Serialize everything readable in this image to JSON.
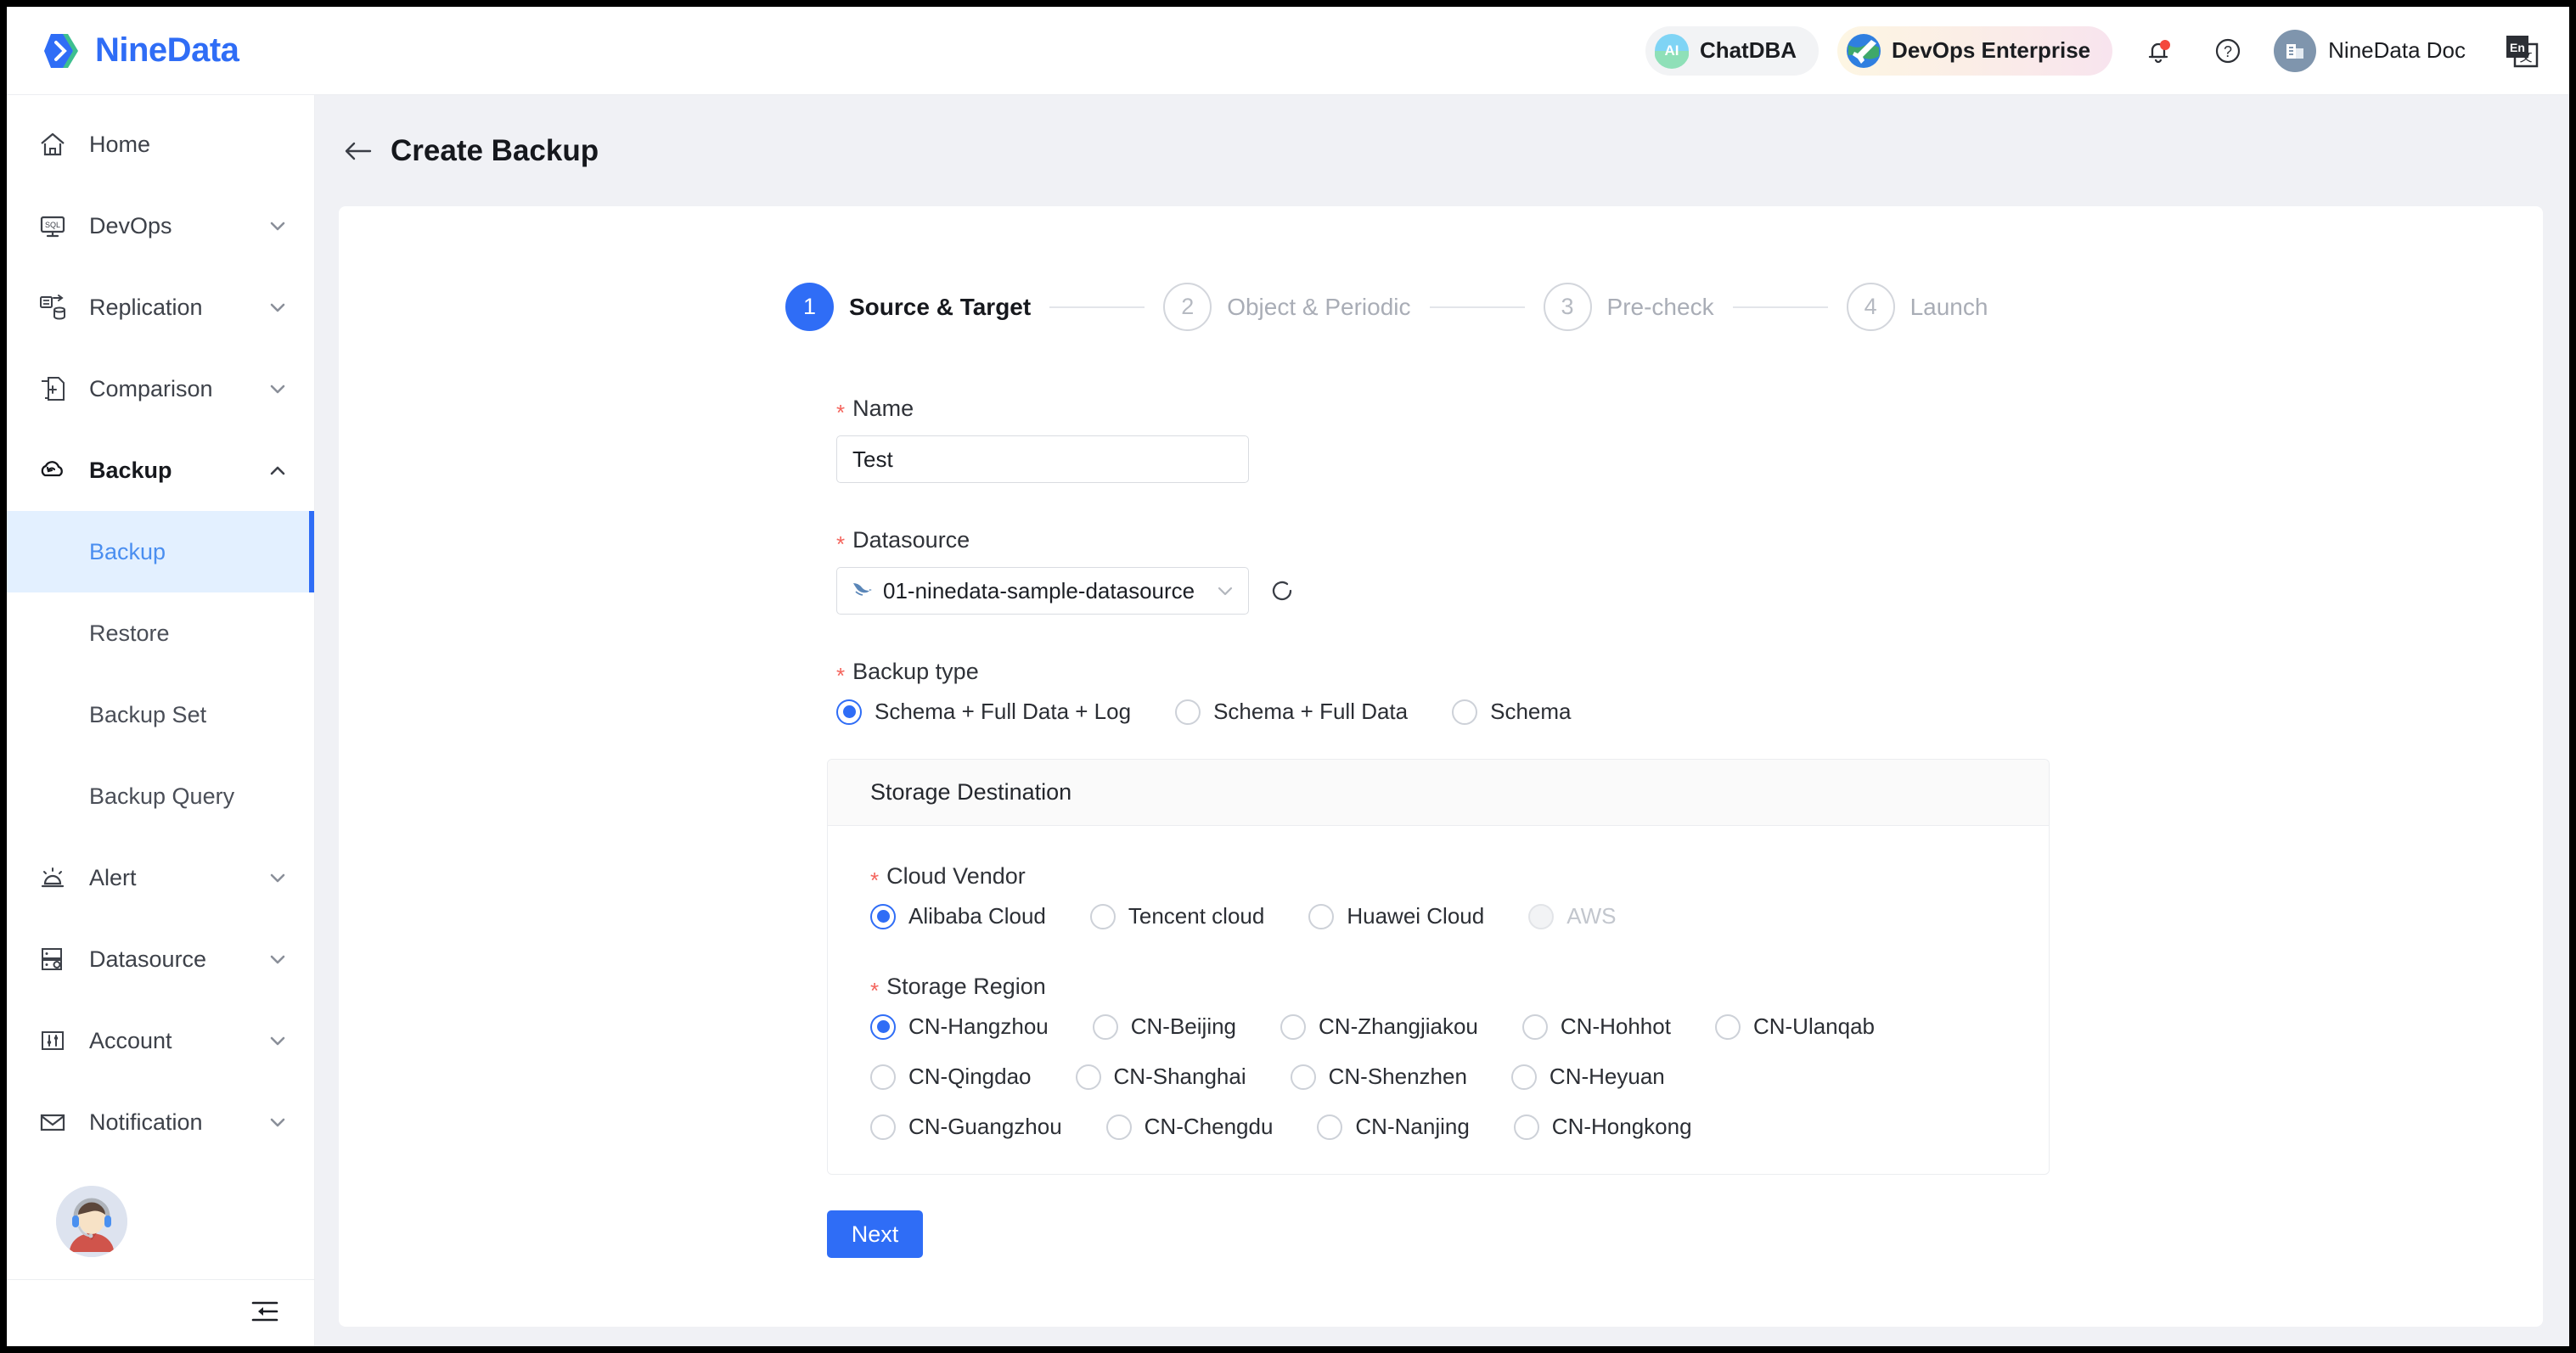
{
  "brand": {
    "name": "NineData",
    "accent": "#2f6df6",
    "logo_icon": "ninedata-logo-icon"
  },
  "topbar": {
    "chatdba": {
      "label": "ChatDBA",
      "icon": "ai-avatar-icon"
    },
    "devops": {
      "label": "DevOps Enterprise",
      "icon": "globe-plane-icon"
    },
    "notification": {
      "icon": "bell-icon",
      "has_badge": true,
      "badge_color": "#f4483c"
    },
    "help": {
      "icon": "question-circle-icon"
    },
    "doc": {
      "label": "NineData Doc",
      "icon": "building-icon"
    },
    "language": {
      "icon": "language-switch-icon",
      "from": "En",
      "to": "文"
    }
  },
  "sidebar": {
    "items": [
      {
        "label": "Home",
        "icon": "home-icon",
        "expandable": false,
        "name": "home"
      },
      {
        "label": "DevOps",
        "icon": "sql-monitor-icon",
        "expandable": true,
        "chevron": "down",
        "name": "devops"
      },
      {
        "label": "Replication",
        "icon": "database-sync-icon",
        "expandable": true,
        "chevron": "down",
        "name": "replication"
      },
      {
        "label": "Comparison",
        "icon": "document-compare-icon",
        "expandable": true,
        "chevron": "down",
        "name": "comparison"
      },
      {
        "label": "Backup",
        "icon": "cloud-backup-icon",
        "expandable": true,
        "chevron": "up",
        "active": true,
        "name": "backup"
      }
    ],
    "backup_children": [
      {
        "label": "Backup",
        "active": true,
        "name": "backup"
      },
      {
        "label": "Restore",
        "active": false,
        "name": "restore"
      },
      {
        "label": "Backup Set",
        "active": false,
        "name": "backup-set"
      },
      {
        "label": "Backup Query",
        "active": false,
        "name": "backup-query"
      }
    ],
    "items_after": [
      {
        "label": "Alert",
        "icon": "siren-icon",
        "expandable": true,
        "chevron": "down",
        "name": "alert"
      },
      {
        "label": "Datasource",
        "icon": "server-icon",
        "expandable": true,
        "chevron": "down",
        "name": "datasource"
      },
      {
        "label": "Account",
        "icon": "sliders-icon",
        "expandable": true,
        "chevron": "down",
        "name": "account"
      },
      {
        "label": "Notification",
        "icon": "envelope-icon",
        "expandable": true,
        "chevron": "down",
        "name": "notification"
      }
    ],
    "avatar": {
      "icon": "support-agent-avatar"
    },
    "collapse": {
      "icon": "collapse-sidebar-icon"
    }
  },
  "page": {
    "back_icon": "back-arrow-icon",
    "title": "Create Backup"
  },
  "steps": [
    {
      "num": "1",
      "label": "Source & Target",
      "state": "done"
    },
    {
      "num": "2",
      "label": "Object & Periodic",
      "state": "todo"
    },
    {
      "num": "3",
      "label": "Pre-check",
      "state": "todo"
    },
    {
      "num": "4",
      "label": "Launch",
      "state": "todo"
    }
  ],
  "form": {
    "name": {
      "label": "Name",
      "required": true,
      "value": "Test",
      "placeholder": ""
    },
    "datasource": {
      "label": "Datasource",
      "required": true,
      "value": "01-ninedata-sample-datasource",
      "icon": "mysql-dolphin-icon",
      "chevron": "chevron-down-icon",
      "refresh_icon": "refresh-icon"
    },
    "backup_type": {
      "label": "Backup type",
      "required": true,
      "options": [
        {
          "label": "Schema + Full Data + Log",
          "selected": true,
          "disabled": false
        },
        {
          "label": "Schema + Full Data",
          "selected": false,
          "disabled": false
        },
        {
          "label": "Schema",
          "selected": false,
          "disabled": false
        }
      ]
    },
    "storage_destination": {
      "title": "Storage Destination",
      "cloud_vendor": {
        "label": "Cloud Vendor",
        "required": true,
        "options": [
          {
            "label": "Alibaba Cloud",
            "selected": true,
            "disabled": false
          },
          {
            "label": "Tencent cloud",
            "selected": false,
            "disabled": false
          },
          {
            "label": "Huawei Cloud",
            "selected": false,
            "disabled": false
          },
          {
            "label": "AWS",
            "selected": false,
            "disabled": true
          }
        ]
      },
      "storage_region": {
        "label": "Storage Region",
        "required": true,
        "rows": [
          [
            {
              "label": "CN-Hangzhou",
              "selected": true
            },
            {
              "label": "CN-Beijing",
              "selected": false
            },
            {
              "label": "CN-Zhangjiakou",
              "selected": false
            },
            {
              "label": "CN-Hohhot",
              "selected": false
            },
            {
              "label": "CN-Ulanqab",
              "selected": false
            }
          ],
          [
            {
              "label": "CN-Qingdao",
              "selected": false
            },
            {
              "label": "CN-Shanghai",
              "selected": false
            },
            {
              "label": "CN-Shenzhen",
              "selected": false
            },
            {
              "label": "CN-Heyuan",
              "selected": false
            }
          ],
          [
            {
              "label": "CN-Guangzhou",
              "selected": false
            },
            {
              "label": "CN-Chengdu",
              "selected": false
            },
            {
              "label": "CN-Nanjing",
              "selected": false
            },
            {
              "label": "CN-Hongkong",
              "selected": false
            }
          ]
        ]
      }
    },
    "next_label": "Next"
  }
}
